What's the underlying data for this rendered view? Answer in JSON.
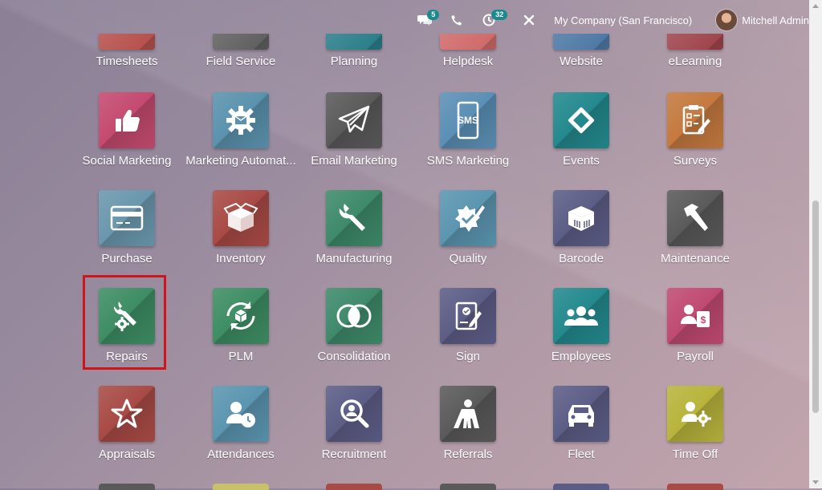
{
  "topbar": {
    "messages_count": "5",
    "activities_count": "32",
    "company": "My Company (San Francisco)",
    "user_name": "Mitchell Admin",
    "icons": [
      "chat-icon",
      "phone-icon",
      "clock-icon",
      "tools-icon"
    ]
  },
  "apps": {
    "row1": [
      {
        "label": "Timesheets",
        "color": "#b7524e",
        "icon": "timesheet-icon"
      },
      {
        "label": "Field Service",
        "color": "#616161",
        "icon": "field-service-icon"
      },
      {
        "label": "Planning",
        "color": "#2c7f8a",
        "icon": "planning-icon"
      },
      {
        "label": "Helpdesk",
        "color": "#d06b6b",
        "icon": "helpdesk-icon"
      },
      {
        "label": "Website",
        "color": "#4f7aa5",
        "icon": "website-icon"
      },
      {
        "label": "eLearning",
        "color": "#a0464d",
        "icon": "elearning-icon"
      }
    ],
    "row2": [
      {
        "label": "Social Marketing",
        "color": "#c44a6f",
        "icon": "thumbs-up-icon"
      },
      {
        "label": "Marketing Automat...",
        "color": "#5a92ad",
        "icon": "gear-icon"
      },
      {
        "label": "Email Marketing",
        "color": "#5a5a5a",
        "icon": "paper-plane-icon"
      },
      {
        "label": "SMS Marketing",
        "color": "#5b8fb5",
        "icon": "sms-phone-icon"
      },
      {
        "label": "Events",
        "color": "#23898d",
        "icon": "ticket-icon"
      },
      {
        "label": "Surveys",
        "color": "#c4793f",
        "icon": "survey-icon"
      }
    ],
    "row3": [
      {
        "label": "Purchase",
        "color": "#6a97ad",
        "icon": "credit-card-icon"
      },
      {
        "label": "Inventory",
        "color": "#a84a45",
        "icon": "box-icon"
      },
      {
        "label": "Manufacturing",
        "color": "#3e8a6a",
        "icon": "wrench-icon"
      },
      {
        "label": "Quality",
        "color": "#5b95b0",
        "icon": "quality-badge-icon"
      },
      {
        "label": "Barcode",
        "color": "#5c5d86",
        "icon": "barcode-box-icon"
      },
      {
        "label": "Maintenance",
        "color": "#5a5a5a",
        "icon": "hammer-icon"
      }
    ],
    "row4": [
      {
        "label": "Repairs",
        "color": "#3d8d63",
        "icon": "repair-gear-icon"
      },
      {
        "label": "PLM",
        "color": "#3d8d63",
        "icon": "plm-cycle-icon"
      },
      {
        "label": "Consolidation",
        "color": "#3e8a6a",
        "icon": "overlap-circles-icon"
      },
      {
        "label": "Sign",
        "color": "#5c5d86",
        "icon": "sign-document-icon"
      },
      {
        "label": "Employees",
        "color": "#23898d",
        "icon": "people-icon"
      },
      {
        "label": "Payroll",
        "color": "#c04a72",
        "icon": "payroll-icon"
      }
    ],
    "row5": [
      {
        "label": "Appraisals",
        "color": "#a84a45",
        "icon": "star-icon"
      },
      {
        "label": "Attendances",
        "color": "#5b95b0",
        "icon": "user-clock-icon"
      },
      {
        "label": "Recruitment",
        "color": "#5c5d86",
        "icon": "magnifier-user-icon"
      },
      {
        "label": "Referrals",
        "color": "#5a5a5a",
        "icon": "hero-icon"
      },
      {
        "label": "Fleet",
        "color": "#5c5d86",
        "icon": "car-icon"
      },
      {
        "label": "Time Off",
        "color": "#b8b43c",
        "icon": "user-gear-icon"
      }
    ],
    "row6_colors": [
      "#5a5a5a",
      "#c9c06a",
      "#a84a45",
      "#5a5a5a",
      "#5c5d86",
      "#a84a45"
    ]
  }
}
